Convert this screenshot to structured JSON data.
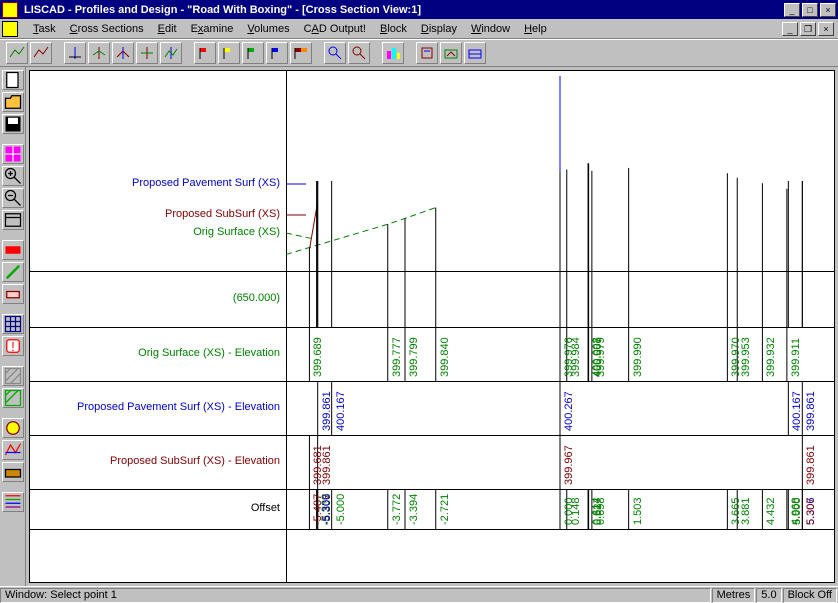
{
  "window": {
    "title": "LISCAD - Profiles and Design - \"Road With Boxing\" - [Cross Section View:1]"
  },
  "menu": {
    "task": "Task",
    "cross_sections": "Cross Sections",
    "edit": "Edit",
    "examine": "Examine",
    "volumes": "Volumes",
    "cad_output": "CAD Output!",
    "block": "Block",
    "display": "Display",
    "window": "Window",
    "help": "Help"
  },
  "legend": {
    "proposed_pavement": "Proposed Pavement Surf (XS)",
    "proposed_subsurf": "Proposed SubSurf (XS)",
    "orig_surface": "Orig Surface (XS)",
    "chainage": "(650.000)"
  },
  "row_labels": {
    "orig_elev": "Orig Surface (XS) - Elevation",
    "pave_elev": "Proposed Pavement Surf (XS) - Elevation",
    "sub_elev": "Proposed SubSurf (XS) - Elevation",
    "offset": "Offset"
  },
  "status": {
    "main": "Window: Select point 1",
    "units": "Metres",
    "scale": "5.0",
    "block": "Block Off"
  },
  "chart_data": {
    "type": "cross-section",
    "chainage": 650.0,
    "label_col_width": 256,
    "offsets": [
      -5.487,
      -5.33,
      -5.307,
      -5.306,
      -5.0,
      -3.772,
      -3.394,
      -2.721,
      0.0,
      0.148,
      0.614,
      0.627,
      0.698,
      1.503,
      3.665,
      3.881,
      4.432,
      4.968,
      5.0,
      5.306,
      5.307
    ],
    "orig_surface_elev": {
      "color": "#008000",
      "values": {
        "-5.487": 399.689,
        "-3.772": 399.777,
        "-3.394": 399.799,
        "-2.721": 399.84,
        "0.000": 399.976,
        "0.148": 399.984,
        "0.614": 400.008,
        "0.627": 400.007,
        "0.698": 399.979,
        "1.503": 399.99,
        "3.665": 399.97,
        "3.881": 399.953,
        "4.432": 399.932,
        "4.968": 399.911
      }
    },
    "proposed_pavement_elev": {
      "color": "#0000cc",
      "values": {
        "-5.306": 399.861,
        "-5.000": 400.167,
        "0.000": 400.267,
        "5.000": 400.167,
        "5.306": 399.861
      }
    },
    "proposed_subsurf_elev": {
      "color": "#800000",
      "values": {
        "-5.487": 399.681,
        "-5.307": 399.861,
        "0.000": 399.967,
        "5.307": 399.861
      }
    },
    "yrange": [
      399.6,
      400.3
    ],
    "xrange": [
      -6.0,
      6.0
    ]
  }
}
